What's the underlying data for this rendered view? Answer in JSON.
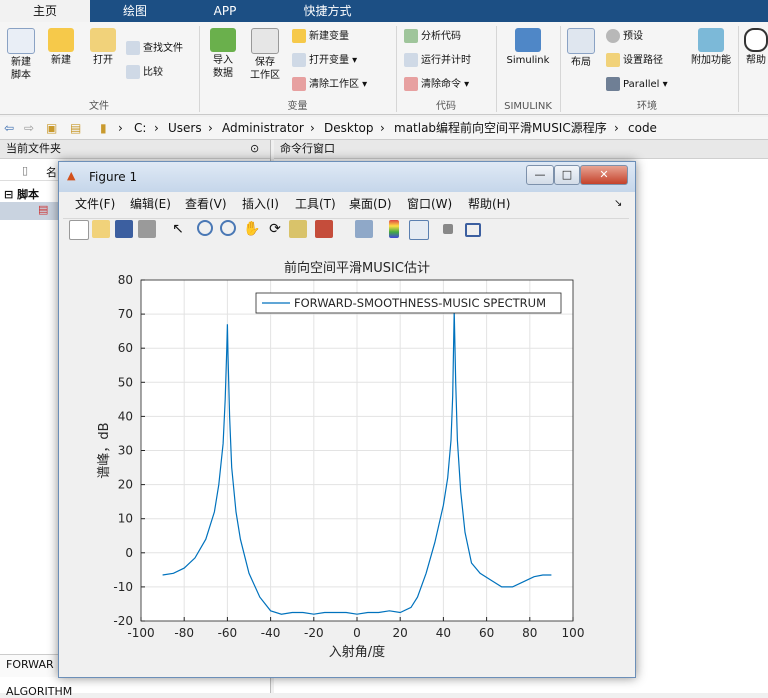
{
  "tabs": [
    "主页",
    "绘图",
    "APP",
    "快捷方式"
  ],
  "ribbon": {
    "file": {
      "new_script": "新建\n脚本",
      "new": "新建",
      "open": "打开",
      "find_files": "查找文件",
      "compare": "比较",
      "group": "文件"
    },
    "variable": {
      "import": "导入\n数据",
      "save_ws": "保存\n工作区",
      "new_var": "新建变量",
      "open_var": "打开变量",
      "clear_ws": "清除工作区",
      "group": "变量"
    },
    "code": {
      "analyze": "分析代码",
      "run_time": "运行并计时",
      "clear_cmds": "清除命令",
      "group": "代码"
    },
    "simulink": {
      "label": "Simulink",
      "group": "SIMULINK"
    },
    "env": {
      "layout": "布局",
      "prefs": "预设",
      "set_path": "设置路径",
      "parallel": "Parallel",
      "addons": "附加功能",
      "help": "帮助",
      "group": "环境"
    }
  },
  "address": [
    "C:",
    "Users",
    "Administrator",
    "Desktop",
    "matlab编程前向空间平滑MUSIC源程序",
    "code"
  ],
  "left_panel": {
    "title": "当前文件夹",
    "col_name": "名",
    "section": "脚本",
    "bottom1": "FORWAR",
    "bottom2": "ALGORITHM"
  },
  "cmd_panel": {
    "title": "命令行窗口"
  },
  "figure": {
    "title": "Figure 1",
    "menus": [
      "文件(F)",
      "编辑(E)",
      "查看(V)",
      "插入(I)",
      "工具(T)",
      "桌面(D)",
      "窗口(W)",
      "帮助(H)"
    ]
  },
  "chart_data": {
    "type": "line",
    "title": "前向空间平滑MUSIC估计",
    "xlabel": "入射角/度",
    "ylabel": "谱峰，dB",
    "xlim": [
      -100,
      100
    ],
    "ylim": [
      -20,
      80
    ],
    "xticks": [
      -100,
      -80,
      -60,
      -40,
      -20,
      0,
      20,
      40,
      60,
      80,
      100
    ],
    "yticks": [
      -20,
      -10,
      0,
      10,
      20,
      30,
      40,
      50,
      60,
      70,
      80
    ],
    "grid": true,
    "legend_position": "top-right",
    "series": [
      {
        "name": "FORWARD-SMOOTHNESS-MUSIC SPECTRUM",
        "color": "#0072bd",
        "x": [
          -90,
          -85,
          -80,
          -75,
          -70,
          -66,
          -64,
          -62,
          -61,
          -60.3,
          -60,
          -59.7,
          -59,
          -58,
          -56,
          -54,
          -50,
          -45,
          -40,
          -35,
          -30,
          -25,
          -20,
          -15,
          -10,
          -5,
          0,
          5,
          10,
          15,
          20,
          25,
          28,
          32,
          36,
          40,
          42,
          43.5,
          44.3,
          45,
          45.7,
          46.5,
          48,
          50,
          53,
          57,
          62,
          67,
          72,
          77,
          82,
          86,
          90
        ],
        "y": [
          -6.5,
          -6,
          -4.5,
          -1.5,
          4,
          12,
          20,
          32,
          45,
          60,
          67,
          58,
          40,
          25,
          12,
          4,
          -6,
          -13,
          -17,
          -18,
          -17.5,
          -17.5,
          -18,
          -17.5,
          -17.5,
          -17.5,
          -18,
          -17.5,
          -17.5,
          -17,
          -17.5,
          -16,
          -13,
          -6,
          3,
          14,
          22,
          33,
          46,
          71,
          50,
          33,
          18,
          6,
          -3,
          -6,
          -8,
          -10,
          -10,
          -8.5,
          -7,
          -6.5,
          -6.5
        ]
      }
    ]
  }
}
